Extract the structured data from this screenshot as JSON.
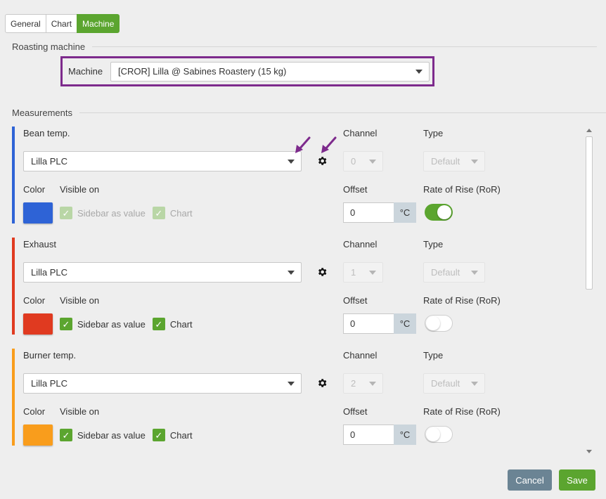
{
  "tabs": [
    {
      "label": "General",
      "active": false
    },
    {
      "label": "Chart",
      "active": false
    },
    {
      "label": "Machine",
      "active": true
    }
  ],
  "roasting_machine": {
    "heading": "Roasting machine",
    "machine_label": "Machine",
    "machine_value": "[CROR] Lilla @ Sabines Roastery (15 kg)"
  },
  "measurements": {
    "heading": "Measurements",
    "labels": {
      "channel": "Channel",
      "type": "Type",
      "color": "Color",
      "visible_on": "Visible on",
      "offset": "Offset",
      "ror": "Rate of Rise (RoR)",
      "sidebar_as_value": "Sidebar as value",
      "chart": "Chart",
      "unit": "°C"
    },
    "items": [
      {
        "name": "Bean temp.",
        "source": "Lilla PLC",
        "channel": "0",
        "type": "Default",
        "color": "#2e63d6",
        "offset": "0",
        "sidebar_checked": true,
        "chart_checked": true,
        "disabled_checks": true,
        "ror": true
      },
      {
        "name": "Exhaust",
        "source": "Lilla PLC",
        "channel": "1",
        "type": "Default",
        "color": "#e03a20",
        "offset": "0",
        "sidebar_checked": true,
        "chart_checked": true,
        "disabled_checks": false,
        "ror": false
      },
      {
        "name": "Burner temp.",
        "source": "Lilla PLC",
        "channel": "2",
        "type": "Default",
        "color": "#f99d1c",
        "offset": "0",
        "sidebar_checked": true,
        "chart_checked": true,
        "disabled_checks": false,
        "ror": false
      }
    ]
  },
  "buttons": {
    "cancel": "Cancel",
    "save": "Save"
  },
  "colors": {
    "accent": "#5ba52f",
    "highlight": "#7d2a8c",
    "cancel": "#6b8494"
  }
}
